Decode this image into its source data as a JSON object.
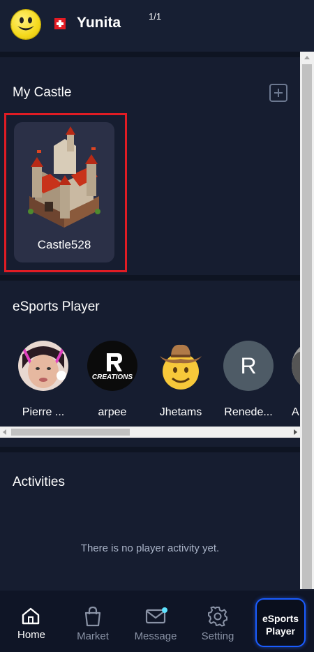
{
  "header": {
    "username": "Yunita",
    "page_indicator": "1/1"
  },
  "castle_section": {
    "title": "My Castle",
    "castles": [
      {
        "name": "Castle528"
      }
    ]
  },
  "esports_section": {
    "title": "eSports Player",
    "players": [
      {
        "name": "Pierre ..."
      },
      {
        "name": "arpee",
        "logo_text": "CREATIONS"
      },
      {
        "name": "Jhetams"
      },
      {
        "name": "Renede...",
        "initial": "R"
      },
      {
        "name": "A"
      }
    ]
  },
  "activities_section": {
    "title": "Activities",
    "empty_message": "There is no player activity yet."
  },
  "bottom_nav": {
    "items": [
      {
        "label": "Home",
        "icon": "home-icon"
      },
      {
        "label": "Market",
        "icon": "shopping-bag-icon"
      },
      {
        "label": "Message",
        "icon": "mail-icon"
      },
      {
        "label": "Setting",
        "icon": "gear-icon"
      }
    ],
    "esports_button": "eSports Player"
  },
  "colors": {
    "background": "#141b2d",
    "highlight": "#e01c24",
    "esports_border": "#1a5cff",
    "notification_dot": "#5ee3ff"
  }
}
